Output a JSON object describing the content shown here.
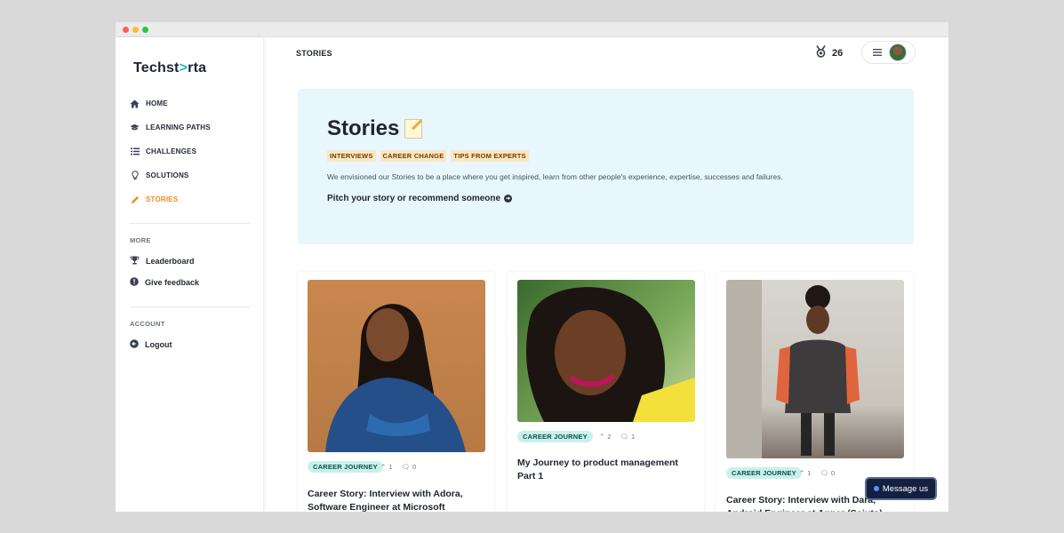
{
  "app": {
    "logo_text_a": "Techst",
    "logo_text_arrow": ">",
    "logo_text_b": "rta"
  },
  "sidebar": {
    "items": [
      {
        "label": "HOME",
        "icon": "home-icon"
      },
      {
        "label": "LEARNING PATHS",
        "icon": "graduation-cap-icon"
      },
      {
        "label": "CHALLENGES",
        "icon": "list-icon"
      },
      {
        "label": "SOLUTIONS",
        "icon": "lightbulb-icon"
      },
      {
        "label": "STORIES",
        "icon": "pencil-icon",
        "active": true
      }
    ],
    "more_label": "MORE",
    "more_items": [
      {
        "label": "Leaderboard",
        "icon": "trophy-icon"
      },
      {
        "label": "Give feedback",
        "icon": "exclamation-icon"
      }
    ],
    "account_label": "ACCOUNT",
    "account_items": [
      {
        "label": "Logout",
        "icon": "logout-icon"
      }
    ]
  },
  "header": {
    "title": "STORIES",
    "points": "26"
  },
  "hero": {
    "title": "Stories",
    "tags": [
      "INTERVIEWS",
      "CAREER CHANGE",
      "TIPS FROM EXPERTS"
    ],
    "description": "We envisioned our Stories to be a place where you get inspired, learn from other people's experience, expertise, successes and failures.",
    "pitch": "Pitch your story or recommend someone"
  },
  "cards": [
    {
      "tag": "CAREER JOURNEY",
      "upvotes": "1",
      "comments": "0",
      "title": "Career Story: Interview with Adora, Software Engineer at Microsoft"
    },
    {
      "tag": "CAREER JOURNEY",
      "upvotes": "2",
      "comments": "1",
      "title": "My Journey to product management Part 1"
    },
    {
      "tag": "CAREER JOURNEY",
      "upvotes": "1",
      "comments": "0",
      "title": "Career Story: Interview with Dara, Android Engineer at Apper (Sojuto)"
    }
  ],
  "message_button": "Message us",
  "colors": {
    "accent": "#f08a24",
    "hero_bg": "#e8f6fd",
    "chip_bg": "#c8f1ea",
    "tag_bg": "#fde6c2",
    "message_bg": "#142041"
  }
}
